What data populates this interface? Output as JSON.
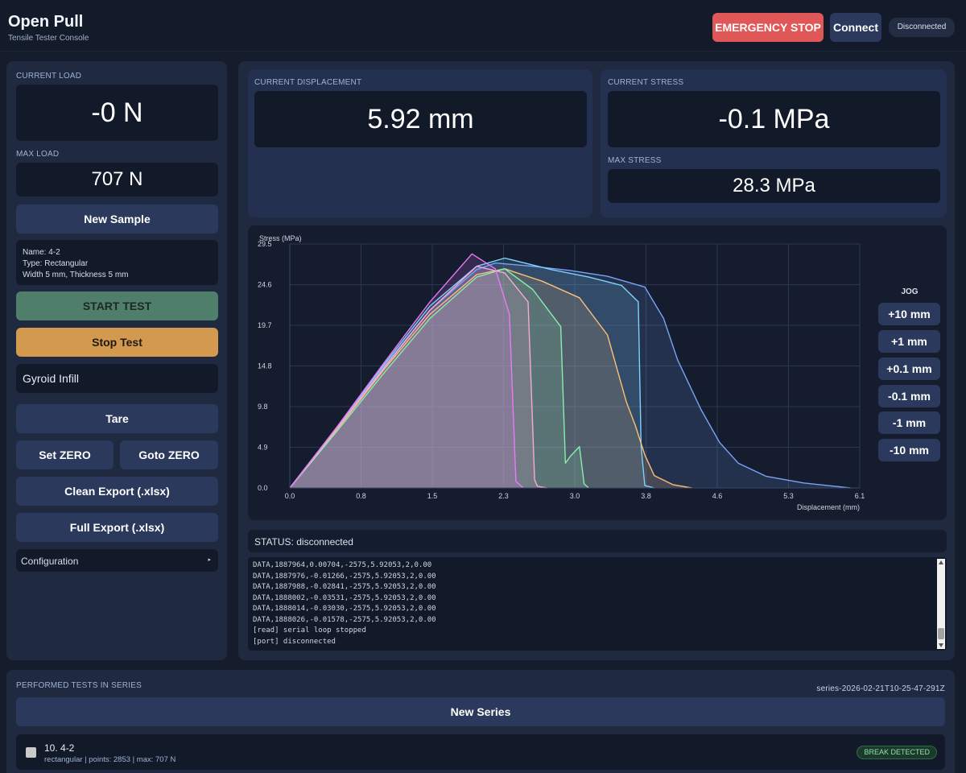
{
  "header": {
    "title": "Open Pull",
    "subtitle": "Tensile Tester Console",
    "estop_label": "EMERGENCY STOP",
    "connect_label": "Connect",
    "connection_status": "Disconnected"
  },
  "left": {
    "current_load_label": "CURRENT LOAD",
    "current_load_value": "-0 N",
    "max_load_label": "MAX LOAD",
    "max_load_value": "707 N",
    "new_sample_label": "New Sample",
    "sample_info": {
      "name_line": "Name: 4-2",
      "type_line": "Type: Rectangular",
      "dims_line": "Width 5 mm, Thickness 5 mm"
    },
    "start_test_label": "START TEST",
    "stop_test_label": "Stop Test",
    "sample_note_value": "Gyroid Infill",
    "tare_label": "Tare",
    "set_zero_label": "Set ZERO",
    "goto_zero_label": "Goto ZERO",
    "clean_export_label": "Clean Export (.xlsx)",
    "full_export_label": "Full Export (.xlsx)",
    "configuration_label": "Configuration",
    "configuration_arrow": "▸"
  },
  "metrics": {
    "displacement_label": "CURRENT DISPLACEMENT",
    "displacement_value": "5.92 mm",
    "stress_label": "CURRENT STRESS",
    "stress_value": "-0.1 MPa",
    "max_stress_label": "MAX STRESS",
    "max_stress_value": "28.3 MPa"
  },
  "jog": {
    "title": "JOG",
    "buttons": [
      "+10 mm",
      "+1 mm",
      "+0.1 mm",
      "-0.1 mm",
      "-1 mm",
      "-10 mm"
    ]
  },
  "status_text": "STATUS: disconnected",
  "log_lines": [
    "DATA,1887964,0.00704,-2575,5.92053,2,0.00",
    "DATA,1887976,-0.01266,-2575,5.92053,2,0.00",
    "DATA,1887988,-0.02841,-2575,5.92053,2,0.00",
    "DATA,1888002,-0.03531,-2575,5.92053,2,0.00",
    "DATA,1888014,-0.03030,-2575,5.92053,2,0.00",
    "DATA,1888026,-0.01578,-2575,5.92053,2,0.00",
    "[read] serial loop stopped",
    "[port] disconnected"
  ],
  "series": {
    "section_label": "PERFORMED TESTS IN SERIES",
    "series_id": "series-2026-02-21T10-25-47-291Z",
    "new_series_label": "New Series",
    "tests": [
      {
        "name": "10. 4-2",
        "meta": "rectangular | points: 2853 | max: 707 N",
        "badge": "BREAK DETECTED"
      }
    ]
  },
  "chart_data": {
    "type": "area",
    "xlabel": "Displacement (mm)",
    "ylabel": "Stress (MPa)",
    "xlim": [
      0,
      6.1
    ],
    "ylim": [
      0,
      29.5
    ],
    "x_ticks": [
      "0.0",
      "0.8",
      "1.5",
      "2.3",
      "3.0",
      "3.8",
      "4.6",
      "5.3",
      "6.1"
    ],
    "y_ticks": [
      "0.0",
      "4.9",
      "9.8",
      "14.8",
      "19.7",
      "24.6",
      "29.5"
    ],
    "grid": true,
    "series": [
      {
        "color": "#7aa2f7",
        "x": [
          0,
          0.5,
          1.0,
          1.5,
          2.0,
          2.2,
          2.6,
          3.0,
          3.4,
          3.8,
          4.0,
          4.15,
          4.4,
          4.6,
          4.8,
          5.1,
          5.5,
          6.0
        ],
        "y": [
          0,
          7.2,
          14.6,
          21.5,
          26.4,
          27.2,
          26.8,
          26.3,
          25.6,
          24.3,
          20.5,
          15.5,
          9.5,
          5.5,
          3.0,
          1.4,
          0.6,
          0
        ]
      },
      {
        "color": "#7dd3fc",
        "x": [
          0,
          0.5,
          1.0,
          1.5,
          2.0,
          2.3,
          2.8,
          3.2,
          3.55,
          3.73,
          3.76,
          3.8,
          3.9
        ],
        "y": [
          0,
          7.3,
          14.8,
          22.0,
          26.8,
          27.8,
          26.4,
          25.5,
          24.5,
          22.5,
          5.0,
          0.3,
          0
        ]
      },
      {
        "color": "#fbbf77",
        "x": [
          0,
          0.5,
          1.0,
          1.5,
          2.0,
          2.3,
          2.7,
          3.1,
          3.4,
          3.6,
          3.7,
          3.8,
          3.9,
          4.1,
          4.3
        ],
        "y": [
          0,
          7.0,
          14.2,
          21.0,
          25.8,
          26.5,
          25.0,
          23.0,
          18.5,
          10.5,
          7.5,
          4.0,
          1.5,
          0.4,
          0
        ]
      },
      {
        "color": "#86efac",
        "x": [
          0,
          0.5,
          1.0,
          1.5,
          2.0,
          2.3,
          2.6,
          2.9,
          2.95,
          3.0,
          3.1,
          3.15,
          3.2
        ],
        "y": [
          0,
          6.8,
          13.8,
          20.5,
          25.5,
          26.5,
          24.0,
          19.5,
          3.0,
          3.8,
          5.0,
          0.5,
          0
        ]
      },
      {
        "color": "#f9a8d4",
        "x": [
          0,
          0.5,
          1.0,
          1.5,
          2.0,
          2.3,
          2.55,
          2.62,
          2.65,
          2.75
        ],
        "y": [
          0,
          7.1,
          14.4,
          21.5,
          26.8,
          26.0,
          22.5,
          1.0,
          0.2,
          0
        ]
      },
      {
        "color": "#e879f9",
        "x": [
          0,
          0.5,
          1.0,
          1.5,
          1.95,
          2.2,
          2.35,
          2.42,
          2.5
        ],
        "y": [
          0,
          7.3,
          15.0,
          22.5,
          28.3,
          26.5,
          21.0,
          0.8,
          0
        ]
      }
    ]
  }
}
